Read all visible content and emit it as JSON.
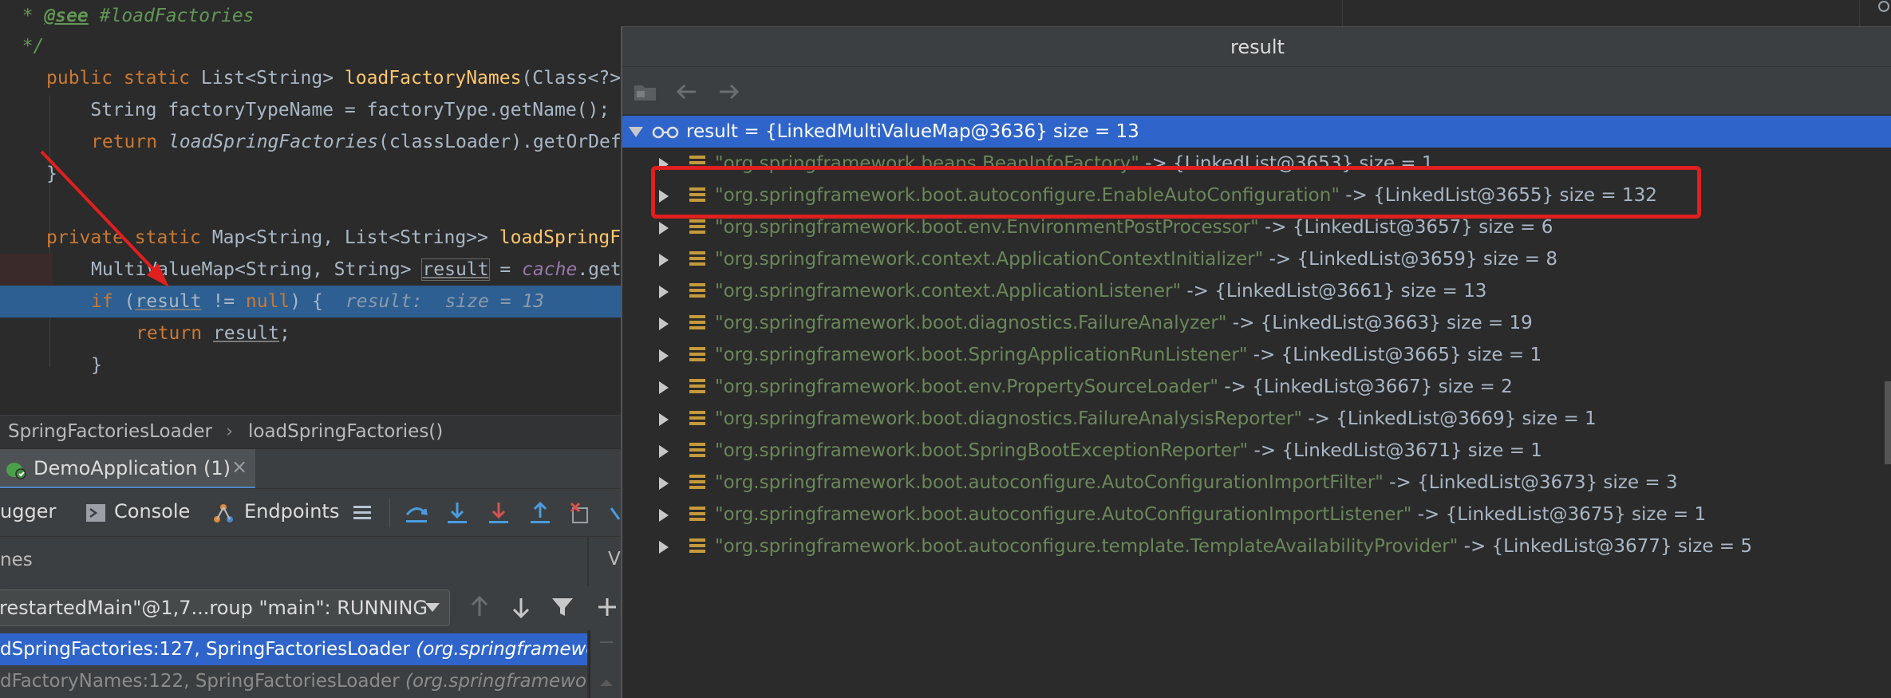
{
  "editor": {
    "lines": [
      {
        "indent": "  * ",
        "tag": "@see",
        "rest": " #loadFactories"
      },
      {
        "text": "  */"
      },
      {
        "kw": "public static ",
        "type": "List<String> ",
        "fn": "loadFactoryNames",
        "rest": "(Class<?>"
      },
      {
        "text": "    String factoryTypeName = factoryType.getName();"
      },
      {
        "kw": "return ",
        "call": "loadSpringFactories",
        "rest": "(classLoader).getOrDef"
      },
      {
        "text": "}"
      },
      {
        "kw": "private static ",
        "type": "Map<String, List<String>> ",
        "fn": "loadSpringF"
      },
      {
        "pre": "MultiValueMap<String, String> ",
        "var": "result",
        "mid": " = ",
        "field": "cache",
        "rest": ".get"
      },
      {
        "kw": "if ",
        "pre": "(",
        "var": "result",
        "mid": " != ",
        "kw2": "null",
        "rest": ") {",
        "hint": "result:  size = 13"
      },
      {
        "kw": "return ",
        "var": "result",
        "rest": ";"
      },
      {
        "text": "}"
      }
    ]
  },
  "breadcrumb": {
    "class_name": "SpringFactoriesLoader",
    "separator": "›",
    "method_name": "loadSpringFactories()"
  },
  "run_tab": {
    "label": "DemoApplication (1)",
    "close": "×"
  },
  "debugger_toolbar": {
    "debugger_label": "ugger",
    "console_label": "Console",
    "endpoints_label": "Endpoints"
  },
  "frames": {
    "header": "nes",
    "vars_header": "V",
    "thread_select": "restartedMain\"@1,7...roup \"main\": RUNNING",
    "items": [
      {
        "loc": "dSpringFactories:127, SpringFactoriesLoader ",
        "pkg": "(org.springframewo"
      },
      {
        "loc": "dFactoryNames:122, SpringFactoriesLoader ",
        "pkg": "(org.springframework"
      }
    ]
  },
  "popup": {
    "title": "result",
    "root": {
      "name": "result",
      "value": " = {LinkedMultiValueMap@3636}",
      "size": "  size = 13"
    },
    "entries": [
      {
        "key": "\"org.springframework.beans.BeanInfoFactory\"",
        "arrow": " -> ",
        "value": "{LinkedList@3653}",
        "size": "  size = 1"
      },
      {
        "key": "\"org.springframework.boot.autoconfigure.EnableAutoConfiguration\"",
        "arrow": " -> ",
        "value": "{LinkedList@3655}",
        "size": "  size = 132"
      },
      {
        "key": "\"org.springframework.boot.env.EnvironmentPostProcessor\"",
        "arrow": " -> ",
        "value": "{LinkedList@3657}",
        "size": "  size = 6"
      },
      {
        "key": "\"org.springframework.context.ApplicationContextInitializer\"",
        "arrow": " -> ",
        "value": "{LinkedList@3659}",
        "size": "  size = 8"
      },
      {
        "key": "\"org.springframework.context.ApplicationListener\"",
        "arrow": " -> ",
        "value": "{LinkedList@3661}",
        "size": "  size = 13"
      },
      {
        "key": "\"org.springframework.boot.diagnostics.FailureAnalyzer\"",
        "arrow": " -> ",
        "value": "{LinkedList@3663}",
        "size": "  size = 19"
      },
      {
        "key": "\"org.springframework.boot.SpringApplicationRunListener\"",
        "arrow": " -> ",
        "value": "{LinkedList@3665}",
        "size": "  size = 1"
      },
      {
        "key": "\"org.springframework.boot.env.PropertySourceLoader\"",
        "arrow": " -> ",
        "value": "{LinkedList@3667}",
        "size": "  size = 2"
      },
      {
        "key": "\"org.springframework.boot.diagnostics.FailureAnalysisReporter\"",
        "arrow": " -> ",
        "value": "{LinkedList@3669}",
        "size": "  size = 1"
      },
      {
        "key": "\"org.springframework.boot.SpringBootExceptionReporter\"",
        "arrow": " -> ",
        "value": "{LinkedList@3671}",
        "size": "  size = 1"
      },
      {
        "key": "\"org.springframework.boot.autoconfigure.AutoConfigurationImportFilter\"",
        "arrow": " -> ",
        "value": "{LinkedList@3673}",
        "size": "  size = 3"
      },
      {
        "key": "\"org.springframework.boot.autoconfigure.AutoConfigurationImportListener\"",
        "arrow": " -> ",
        "value": "{LinkedList@3675}",
        "size": "  size = 1"
      },
      {
        "key": "\"org.springframework.boot.autoconfigure.template.TemplateAvailabilityProvider\"",
        "arrow": " -> ",
        "value": "{LinkedList@3677}",
        "size": "  size = 5"
      }
    ]
  },
  "icons": {
    "popup_toolbar": [
      "folder-icon",
      "back-arrow-icon",
      "forward-arrow-icon"
    ],
    "step_buttons": [
      "step-over-icon",
      "step-into-icon",
      "force-step-into-icon",
      "step-out-icon",
      "drop-frame-icon"
    ]
  },
  "colors": {
    "highlight_line": "#2d5f92",
    "selection": "#2f65ca",
    "annotation_box": "#e01f1f",
    "string": "#6a8759",
    "keyword": "#cc7832"
  }
}
